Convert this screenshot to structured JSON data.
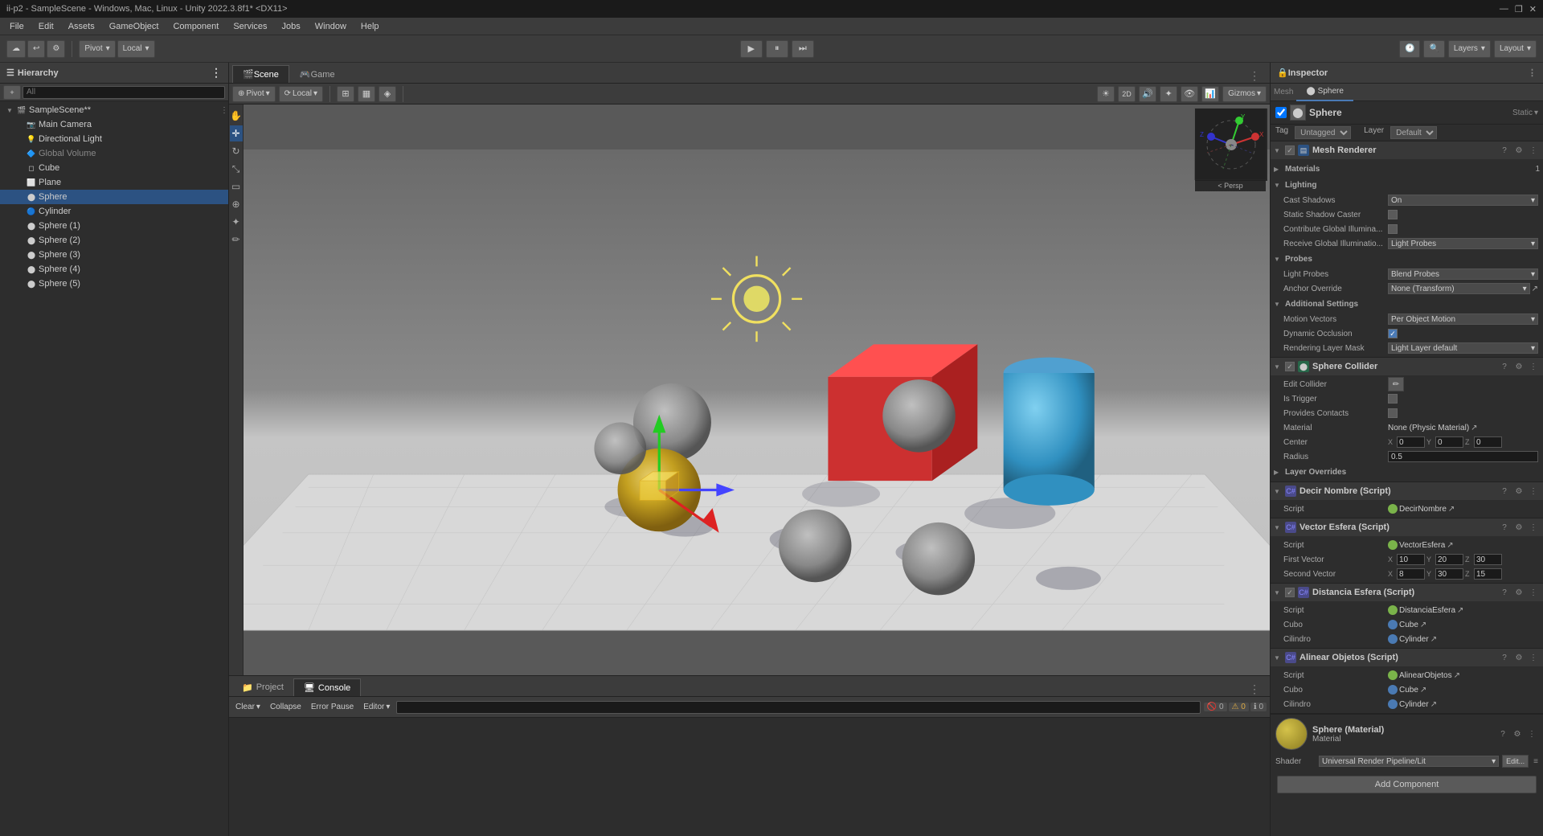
{
  "titlebar": {
    "title": "ii-p2 - SampleScene - Windows, Mac, Linux - Unity 2022.3.8f1* <DX11>",
    "min": "—",
    "max": "❐",
    "close": "✕"
  },
  "menubar": {
    "items": [
      "File",
      "Edit",
      "Assets",
      "GameObject",
      "Component",
      "Services",
      "Jobs",
      "Window",
      "Help"
    ]
  },
  "toolbar": {
    "pivot_label": "Pivot",
    "local_label": "Local",
    "play": "▶",
    "pause": "⏸",
    "step": "⏭",
    "layers_label": "Layers",
    "layout_label": "Layout"
  },
  "hierarchy": {
    "title": "Hierarchy",
    "search_placeholder": "All",
    "items": [
      {
        "label": "SampleScene*",
        "indent": 0,
        "has_arrow": true,
        "icon": "scene"
      },
      {
        "label": "Main Camera",
        "indent": 1,
        "has_arrow": false,
        "icon": "camera"
      },
      {
        "label": "Directional Light",
        "indent": 1,
        "has_arrow": false,
        "icon": "light"
      },
      {
        "label": "Global Volume",
        "indent": 1,
        "has_arrow": false,
        "icon": "volume",
        "disabled": true
      },
      {
        "label": "Cube",
        "indent": 1,
        "has_arrow": false,
        "icon": "cube"
      },
      {
        "label": "Plane",
        "indent": 1,
        "has_arrow": false,
        "icon": "plane"
      },
      {
        "label": "Sphere",
        "indent": 1,
        "has_arrow": false,
        "icon": "sphere",
        "selected": true
      },
      {
        "label": "Cylinder",
        "indent": 1,
        "has_arrow": false,
        "icon": "cylinder"
      },
      {
        "label": "Sphere (1)",
        "indent": 1,
        "has_arrow": false,
        "icon": "sphere"
      },
      {
        "label": "Sphere (2)",
        "indent": 1,
        "has_arrow": false,
        "icon": "sphere"
      },
      {
        "label": "Sphere (3)",
        "indent": 1,
        "has_arrow": false,
        "icon": "sphere"
      },
      {
        "label": "Sphere (4)",
        "indent": 1,
        "has_arrow": false,
        "icon": "sphere"
      },
      {
        "label": "Sphere (5)",
        "indent": 1,
        "has_arrow": false,
        "icon": "sphere"
      }
    ]
  },
  "scene": {
    "tabs": [
      {
        "label": "Scene",
        "active": true
      },
      {
        "label": "Game",
        "active": false
      }
    ],
    "toolbar": {
      "pivot": "Pivot",
      "local": "Local"
    },
    "persp_label": "< Persp"
  },
  "bottom": {
    "tabs": [
      {
        "label": "Project",
        "active": false
      },
      {
        "label": "Console",
        "active": true
      }
    ],
    "console": {
      "clear": "Clear",
      "collapse": "Collapse",
      "error_pause": "Error Pause",
      "editor": "Editor",
      "search_placeholder": "",
      "error_count": "0",
      "warn_count": "0",
      "info_count": "0"
    }
  },
  "inspector": {
    "title": "Inspector",
    "object_name": "Sphere",
    "tag": "Untagged",
    "layer": "Default",
    "components": {
      "mesh_renderer": {
        "name": "Mesh Renderer",
        "enabled": true,
        "sections": {
          "materials": {
            "label": "Materials",
            "count": "1"
          },
          "lighting": {
            "label": "Lighting",
            "cast_shadows": {
              "label": "Cast Shadows",
              "value": "On"
            },
            "static_shadow_caster": {
              "label": "Static Shadow Caster"
            },
            "contribute_global": {
              "label": "Contribute Global Illumina..."
            },
            "receive_global": {
              "label": "Receive Global Illuminatio...",
              "value": "Light Probes"
            }
          },
          "probes": {
            "label": "Probes",
            "light_probes": {
              "label": "Light Probes",
              "value": "Blend Probes"
            },
            "anchor_override": {
              "label": "Anchor Override",
              "value": "None (Transform)"
            }
          },
          "additional": {
            "label": "Additional Settings",
            "motion_vectors": {
              "label": "Motion Vectors",
              "value": "Per Object Motion"
            },
            "dynamic_occlusion": {
              "label": "Dynamic Occlusion",
              "checked": true
            },
            "rendering_layer_mask": {
              "label": "Rendering Layer Mask",
              "value": "Light Layer default"
            }
          }
        }
      },
      "sphere_collider": {
        "name": "Sphere Collider",
        "enabled": true,
        "props": {
          "is_trigger": {
            "label": "Is Trigger",
            "checked": false
          },
          "provides_contacts": {
            "label": "Provides Contacts",
            "checked": false
          },
          "material": {
            "label": "Material",
            "value": "None (Physic Material)"
          },
          "center": {
            "label": "Center",
            "x": "0",
            "y": "0",
            "z": "0"
          },
          "radius": {
            "label": "Radius",
            "value": "0.5"
          },
          "layer_overrides": {
            "label": "Layer Overrides"
          }
        }
      },
      "decir_nombre": {
        "name": "Decir Nombre (Script)",
        "script_name": "DecirNombre"
      },
      "vector_esfera": {
        "name": "Vector Esfera (Script)",
        "script_name": "VectorEsfera",
        "first_vector": {
          "label": "First Vector",
          "x": "10",
          "y": "20",
          "z": "30"
        },
        "second_vector": {
          "label": "Second Vector",
          "x": "8",
          "y": "30",
          "z": "15"
        }
      },
      "distancia_esfera": {
        "name": "Distancia Esfera (Script)",
        "script_name": "DistanciaEsfera",
        "cubo": {
          "label": "Cubo",
          "value": "Cube"
        },
        "cilindro": {
          "label": "Cilindro",
          "value": "Cylinder"
        }
      },
      "alinear_objetos": {
        "name": "Alinear Objetos (Script)",
        "script_name": "AlinearObjetos",
        "cubo": {
          "label": "Cubo",
          "value": "Cube"
        },
        "cilindro": {
          "label": "Cilindro",
          "value": "Cylinder"
        }
      }
    },
    "material": {
      "name": "Sphere (Material)",
      "shader": "Universal Render Pipeline/Lit",
      "edit_label": "Edit..."
    },
    "add_component": "Add Component"
  }
}
